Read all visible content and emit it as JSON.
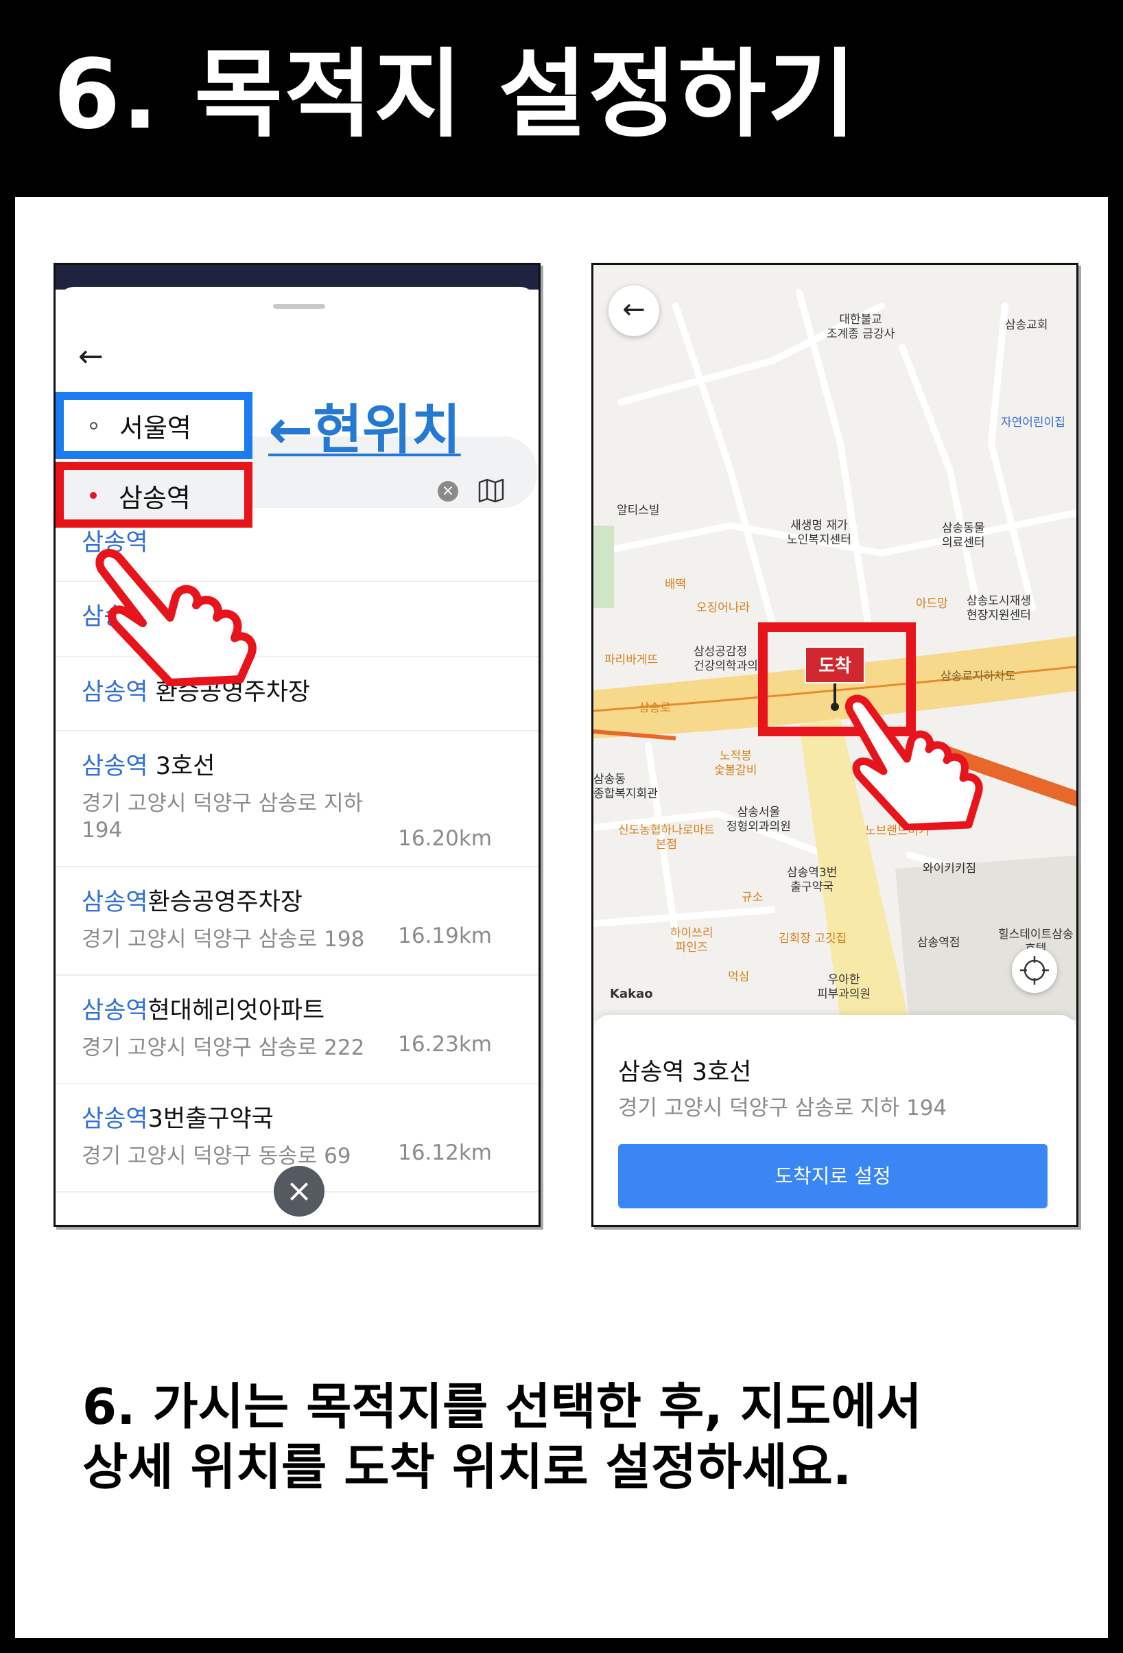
{
  "header": {
    "title": "6. 목적지 설정하기"
  },
  "search_screen": {
    "origin": "서울역",
    "destination": "삼송역",
    "current_location_note": "←현위치",
    "results": [
      {
        "highlight": "삼송역",
        "rest": "",
        "address": "",
        "distance": ""
      },
      {
        "highlight": "삼송역",
        "rest": "",
        "address": "",
        "distance": ""
      },
      {
        "highlight": "삼송역",
        "rest": " 환승공영주차장",
        "address": "",
        "distance": ""
      },
      {
        "highlight": "삼송역",
        "rest": " 3호선",
        "address": "경기 고양시 덕양구 삼송로 지하",
        "address2": "194",
        "distance": "16.20km"
      },
      {
        "highlight": "삼송역",
        "rest": "환승공영주차장",
        "address": "경기 고양시 덕양구 삼송로 198",
        "distance": "16.19km"
      },
      {
        "highlight": "삼송역",
        "rest": "현대헤리엇아파트",
        "address": "경기 고양시 덕양구 삼송로 222",
        "distance": "16.23km"
      },
      {
        "highlight": "삼송역",
        "rest": "3번출구약국",
        "address": "경기 고양시 덕양구 동송로 69",
        "distance": "16.12km"
      }
    ]
  },
  "map_screen": {
    "pin_label": "도착",
    "kakao": "Kakao",
    "labels": [
      "대한불교\n조계종 금강사",
      "삼송교회",
      "자연어린이집",
      "알티스빌",
      "새생명 재가\n노인복지센터",
      "삼송동물\n의료센터",
      "배떡",
      "오징어나라",
      "아드망",
      "삼송도시재생\n현장지원센터",
      "파리바게뜨",
      "삼성공감정\n건강의학과의원",
      "삼송로지하차도",
      "삼송로",
      "삼송동\n종합복지회관",
      "노적봉\n숯불갈비",
      "삼송서울\n정형외과의원",
      "신도농협하나로마트\n본점",
      "노브랜드버거",
      "와이키키짐",
      "삼송역3번\n출구약국",
      "규소",
      "하이쓰리\n파인즈",
      "김회장 고깃집",
      "우아한\n피부과의원",
      "먹심",
      "삼송역점",
      "힐스테이트삼송\n호텔"
    ],
    "place_title": "삼송역 3호선",
    "place_address": "경기 고양시 덕양구 삼송로 지하 194",
    "set_destination_button": "도착지로 설정"
  },
  "caption": {
    "line1": "6. 가시는 목적지를 선택한 후, 지도에서",
    "line2": "상세 위치를 도착 위치로 설정하세요."
  },
  "colors": {
    "highlight_red": "#e8141b",
    "highlight_blue": "#1b7bf0",
    "link_blue": "#2f6fd6",
    "button_blue": "#3b86f5"
  }
}
